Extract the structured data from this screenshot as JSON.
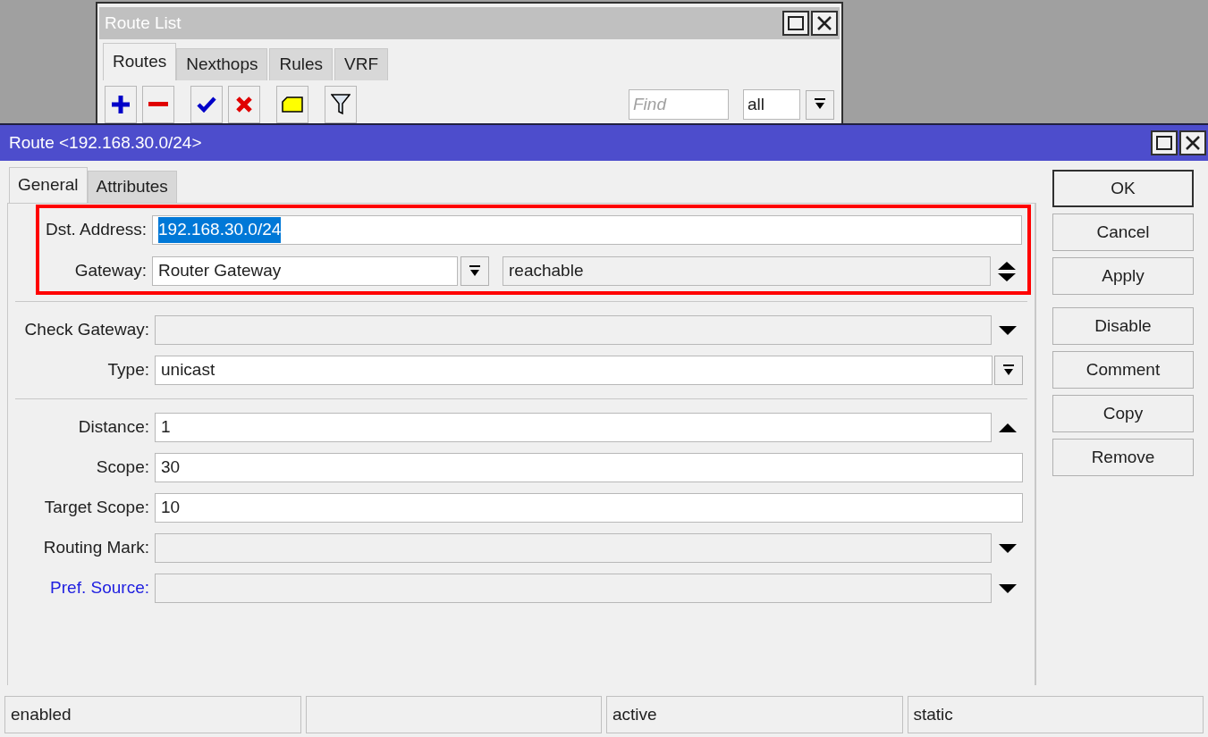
{
  "route_list": {
    "title": "Route List",
    "tabs": [
      {
        "label": "Routes",
        "selected": true
      },
      {
        "label": "Nexthops",
        "selected": false
      },
      {
        "label": "Rules",
        "selected": false
      },
      {
        "label": "VRF",
        "selected": false
      }
    ],
    "toolbar": [
      {
        "kind": "add"
      },
      {
        "kind": "remove"
      },
      {
        "kind": "enable"
      },
      {
        "kind": "disable"
      },
      {
        "kind": "comment"
      },
      {
        "kind": "filter"
      }
    ],
    "find": {
      "placeholder": "Find"
    },
    "filter_select": {
      "value": "all"
    }
  },
  "route": {
    "title": "Route <192.168.30.0/24>",
    "tabs": [
      {
        "label": "General",
        "selected": true
      },
      {
        "label": "Attributes",
        "selected": false
      }
    ],
    "groups": [
      {
        "highlighted": true,
        "rows": [
          {
            "label": "Dst. Address:",
            "kind": "text",
            "value": "192.168.30.0/24",
            "value_selected": true,
            "unset": false,
            "label_link": false
          },
          {
            "label": "Gateway:",
            "kind": "gateway",
            "value": "Router Gateway",
            "status": "reachable",
            "value_selected": false,
            "unset": false,
            "label_link": false
          }
        ]
      },
      {
        "highlighted": false,
        "rows": [
          {
            "label": "Check Gateway:",
            "kind": "dropdown",
            "unset": true,
            "label_link": false
          },
          {
            "label": "Type:",
            "kind": "combo",
            "value": "unicast",
            "value_selected": false,
            "unset": false,
            "label_link": false
          }
        ]
      },
      {
        "highlighted": false,
        "rows": [
          {
            "label": "Distance:",
            "kind": "collapse",
            "value": "1",
            "value_selected": false,
            "unset": false,
            "label_link": false
          },
          {
            "label": "Scope:",
            "kind": "text",
            "value": "30",
            "value_selected": false,
            "unset": false,
            "label_link": false
          },
          {
            "label": "Target Scope:",
            "kind": "text",
            "value": "10",
            "value_selected": false,
            "unset": false,
            "label_link": false
          },
          {
            "label": "Routing Mark:",
            "kind": "dropdown",
            "unset": true,
            "label_link": false
          },
          {
            "label": "Pref. Source:",
            "kind": "dropdown",
            "unset": true,
            "label_link": true
          }
        ]
      }
    ],
    "button_groups": [
      [
        {
          "label": "OK",
          "default": true
        },
        {
          "label": "Cancel",
          "default": false
        },
        {
          "label": "Apply",
          "default": false
        }
      ],
      [
        {
          "label": "Disable",
          "default": false
        },
        {
          "label": "Comment",
          "default": false
        },
        {
          "label": "Copy",
          "default": false
        },
        {
          "label": "Remove",
          "default": false
        }
      ]
    ],
    "status_bar": [
      {
        "kind": "text",
        "text": "enabled"
      },
      {
        "kind": "blank"
      },
      {
        "kind": "text",
        "text": "active"
      },
      {
        "kind": "text",
        "text": "static"
      }
    ]
  }
}
